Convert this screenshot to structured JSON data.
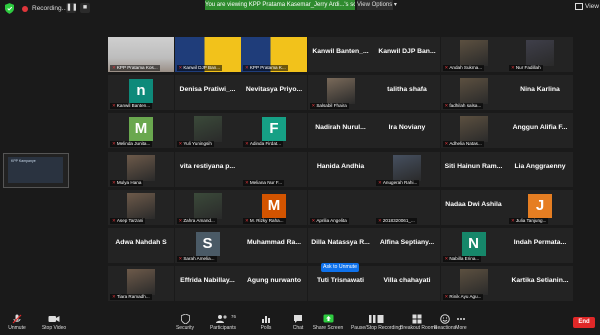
{
  "topbar": {
    "recording_label": "Recording...",
    "banner_text": "You are viewing KPP Pratama Kasemar_Jerry Ardi...'s screen",
    "view_options_label": "View Options ▾",
    "view_label": "View"
  },
  "tiles": [
    {
      "name": "",
      "label": "KPP Pratama Kos...",
      "kind": "video",
      "active": true
    },
    {
      "name": "",
      "label": "Kanwil DJP Ban...",
      "kind": "slide"
    },
    {
      "name": "",
      "label": "KPP Pratama K...",
      "kind": "slide"
    },
    {
      "name": "Kanwil Banten_...",
      "label": "",
      "kind": "name"
    },
    {
      "name": "Kanwil DJP Ban...",
      "label": "",
      "kind": "name"
    },
    {
      "name": "",
      "label": "Andah Sukma...",
      "kind": "photo"
    },
    {
      "name": "",
      "label": "Nur Fadillah",
      "kind": "photo"
    },
    {
      "name": "",
      "label": "Kanwil Banten...",
      "kind": "avatar",
      "letter": "n",
      "color": "#0e8a7a"
    },
    {
      "name": "Denisa Pratiwi_...",
      "label": "",
      "kind": "name"
    },
    {
      "name": "Nevitasya Priyo...",
      "label": "",
      "kind": "name"
    },
    {
      "name": "",
      "label": "Salsabil Fhaira",
      "kind": "photo"
    },
    {
      "name": "talitha shafa",
      "label": "",
      "kind": "name"
    },
    {
      "name": "",
      "label": "fadhilah salsa...",
      "kind": "photo"
    },
    {
      "name": "Nina Karlina",
      "label": "",
      "kind": "name"
    },
    {
      "name": "",
      "label": "Melinda Junita...",
      "kind": "avatar",
      "letter": "M",
      "color": "#6aa84f"
    },
    {
      "name": "",
      "label": "Yuli Yuningsih",
      "kind": "photo"
    },
    {
      "name": "",
      "label": "Adinda Firdat...",
      "kind": "avatar",
      "letter": "F",
      "color": "#16a085"
    },
    {
      "name": "Nadirah Nurul...",
      "label": "",
      "kind": "name"
    },
    {
      "name": "Ira Noviany",
      "label": "",
      "kind": "name"
    },
    {
      "name": "",
      "label": "Adhelia Natas...",
      "kind": "photo"
    },
    {
      "name": "Anggun Alifia F...",
      "label": "",
      "kind": "name"
    },
    {
      "name": "",
      "label": "Mulya Hana",
      "kind": "photo"
    },
    {
      "name": "vita restiyana p...",
      "label": "",
      "kind": "name"
    },
    {
      "name": "",
      "label": "Meliana Nur F...",
      "kind": "blank"
    },
    {
      "name": "Hanida Andhia",
      "label": "",
      "kind": "name"
    },
    {
      "name": "",
      "label": "Anugerah Rahi...",
      "kind": "photo"
    },
    {
      "name": "Siti Hainun Ram...",
      "label": "",
      "kind": "name"
    },
    {
      "name": "Lia Anggraenny",
      "label": "",
      "kind": "name"
    },
    {
      "name": "",
      "label": "Asep Tarzani",
      "kind": "photo"
    },
    {
      "name": "",
      "label": "Zahra Amand...",
      "kind": "photo"
    },
    {
      "name": "",
      "label": "M. Rizky Raha...",
      "kind": "avatar",
      "letter": "M",
      "color": "#d35400"
    },
    {
      "name": "",
      "label": "Aprilia Angelita",
      "kind": "blank"
    },
    {
      "name": "",
      "label": "2018320061_...",
      "kind": "blank"
    },
    {
      "name": "Nadaa Dwi Ashila",
      "label": "",
      "kind": "name"
    },
    {
      "name": "",
      "label": "Julia Tanjung...",
      "kind": "avatar",
      "letter": "J",
      "color": "#e67e22"
    },
    {
      "name": "Adwa Nahdah S",
      "label": "",
      "kind": "name"
    },
    {
      "name": "",
      "label": "Sarah Amelia...",
      "kind": "avatar",
      "letter": "S",
      "color": "#4a5a66"
    },
    {
      "name": "Muhammad Ra...",
      "label": "",
      "kind": "name"
    },
    {
      "name": "Dilla Natassya R...",
      "label": "",
      "kind": "name"
    },
    {
      "name": "Alfina Septiany...",
      "label": "",
      "kind": "name"
    },
    {
      "name": "",
      "label": "Nabilla Erina...",
      "kind": "avatar",
      "letter": "N",
      "color": "#16876a"
    },
    {
      "name": "Indah Permata...",
      "label": "",
      "kind": "name"
    },
    {
      "name": "",
      "label": "Tiara Ramadh...",
      "kind": "photo"
    },
    {
      "name": "Effrida Nabillay...",
      "label": "",
      "kind": "name"
    },
    {
      "name": "Agung nurwanto",
      "label": "",
      "kind": "name"
    },
    {
      "name": "Tuti Trisnawati",
      "label": "",
      "kind": "name"
    },
    {
      "name": "Villa chahayati",
      "label": "",
      "kind": "name"
    },
    {
      "name": "",
      "label": "Rinik Ayu Agu...",
      "kind": "photo"
    },
    {
      "name": "Kartika Setianin...",
      "label": "",
      "kind": "name"
    }
  ],
  "shared_screen": {
    "title": "KPP Kampanye"
  },
  "tooltip": {
    "text": "Ask to Unmute"
  },
  "toolbar": {
    "unmute": "Unmute",
    "stop_video": "Stop Video",
    "security": "Security",
    "participants": "Participants",
    "participants_count": "76",
    "polls": "Polls",
    "chat": "Chat",
    "share_screen": "Share Screen",
    "pause_recording": "Pause/Stop Recording",
    "breakout_rooms": "Breakout Rooms",
    "reactions": "Reactions",
    "more": "More",
    "end": "End",
    "accent": "#e02828",
    "share_color": "#2ecc40"
  }
}
